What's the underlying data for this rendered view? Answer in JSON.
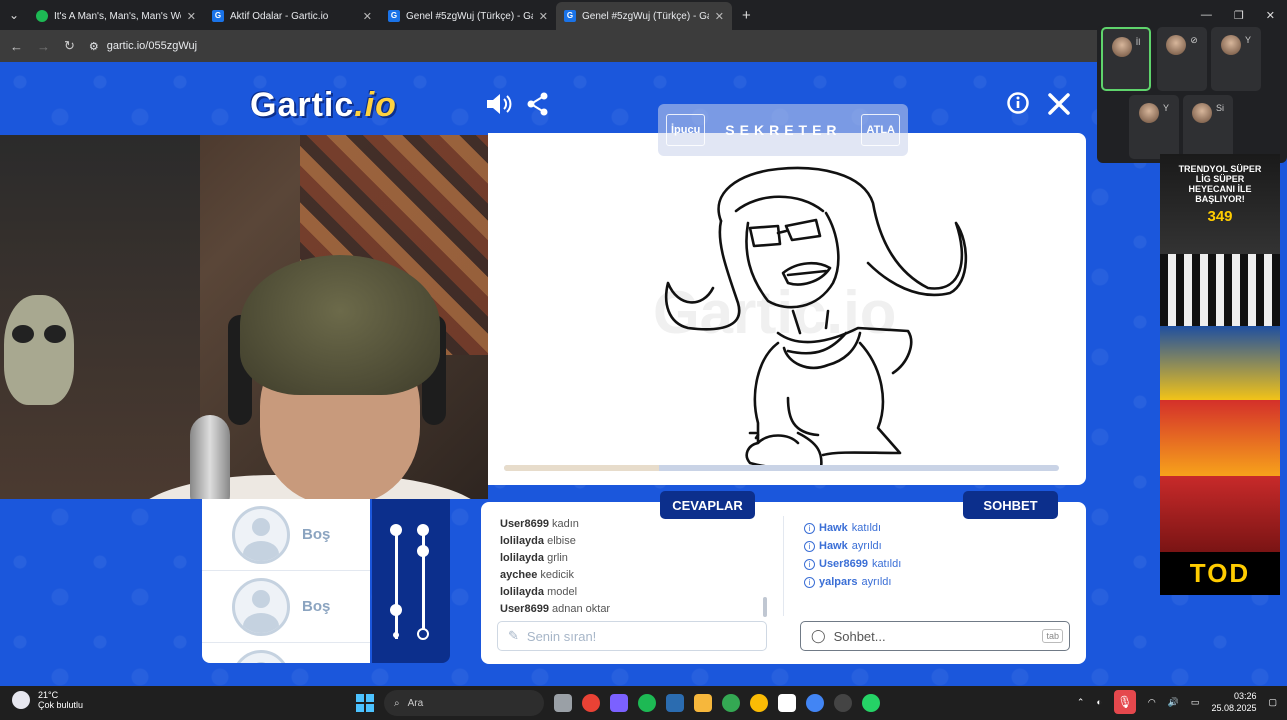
{
  "browser": {
    "tabs": [
      {
        "title": "It's A Man's, Man's, Man's Worl",
        "favicon": "spotify"
      },
      {
        "title": "Aktif Odalar - Gartic.io",
        "favicon": "G"
      },
      {
        "title": "Genel #5zgWuj (Türkçe) - Gartic",
        "favicon": "G"
      },
      {
        "title": "Genel #5zgWuj (Türkçe) - Gartic",
        "favicon": "G"
      }
    ],
    "url": "gartic.io/055zgWuj"
  },
  "game": {
    "logo_main": "Gartic",
    "logo_suffix": ".io",
    "hint_label": "İpucu",
    "word": "SEKRETER",
    "skip_label": "ATLA",
    "watermark": "Gartic.io",
    "timer_progress": 0.28
  },
  "players": [
    {
      "name": "Boş"
    },
    {
      "name": "Boş"
    }
  ],
  "answers": {
    "tab_label": "CEVAPLAR",
    "rows": [
      {
        "user": "User8699",
        "text": "kadın"
      },
      {
        "user": "lolilayda",
        "text": "elbise"
      },
      {
        "user": "lolilayda",
        "text": "grlin"
      },
      {
        "user": "aychee",
        "text": "kedicik"
      },
      {
        "user": "lolilayda",
        "text": "model"
      },
      {
        "user": "User8699",
        "text": "adnan oktar"
      }
    ],
    "placeholder": "Senin sıran!"
  },
  "chat": {
    "tab_label": "SOHBET",
    "rows": [
      {
        "user": "Hawk",
        "text": "katıldı"
      },
      {
        "user": "Hawk",
        "text": "ayrıldı"
      },
      {
        "user": "User8699",
        "text": "katıldı"
      },
      {
        "user": "yalpars",
        "text": "ayrıldı"
      }
    ],
    "placeholder": "Sohbet...",
    "tab_key": "tab"
  },
  "call": {
    "tiles": [
      {
        "label": "İl"
      },
      {
        "label": ""
      },
      {
        "label": "Y"
      },
      {
        "label": "Y"
      },
      {
        "label": "Si"
      }
    ]
  },
  "ads": {
    "headline": "TRENDYOL SÜPER LİG SÜPER HEYECANI İLE BAŞLIYOR!",
    "price": "349",
    "logo": "TOD"
  },
  "taskbar": {
    "temp": "21°C",
    "weather": "Çok bulutlu",
    "search": "Ara",
    "time": "03:26",
    "date": "25.08.2025"
  }
}
